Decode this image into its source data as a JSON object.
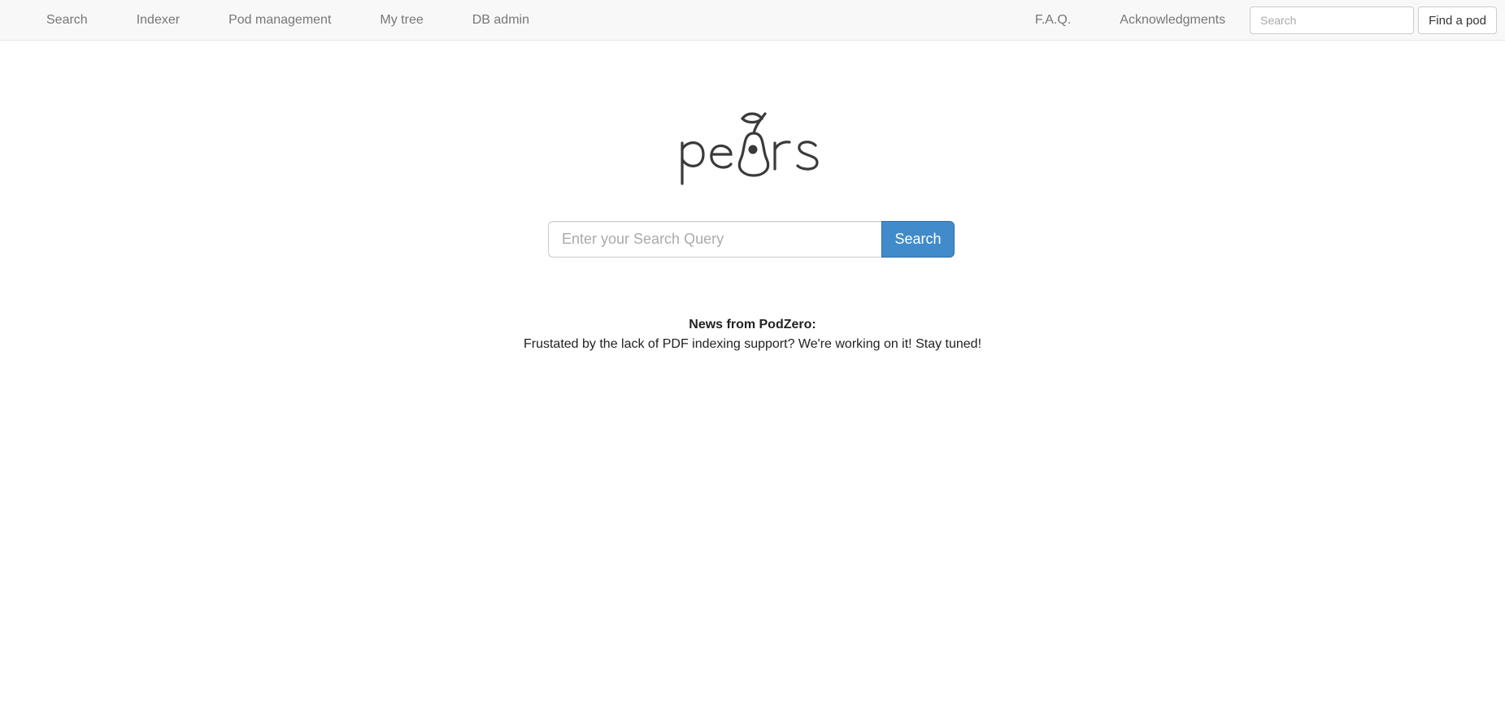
{
  "nav": {
    "left_items": [
      {
        "label": "Search"
      },
      {
        "label": "Indexer"
      },
      {
        "label": "Pod management"
      },
      {
        "label": "My tree"
      },
      {
        "label": "DB admin"
      }
    ],
    "right_items": [
      {
        "label": "F.A.Q."
      },
      {
        "label": "Acknowledgments"
      }
    ],
    "pod_search": {
      "placeholder": "Search",
      "value": ""
    },
    "find_pod_label": "Find a pod"
  },
  "logo": {
    "text": "pears",
    "icon": "pear-icon",
    "color": "#3a3a3a"
  },
  "main_search": {
    "placeholder": "Enter your Search Query",
    "value": "",
    "button_label": "Search",
    "button_color": "#428bca"
  },
  "news": {
    "title": "News from PodZero:",
    "body": "Frustated by the lack of PDF indexing support? We're working on it! Stay tuned!"
  }
}
